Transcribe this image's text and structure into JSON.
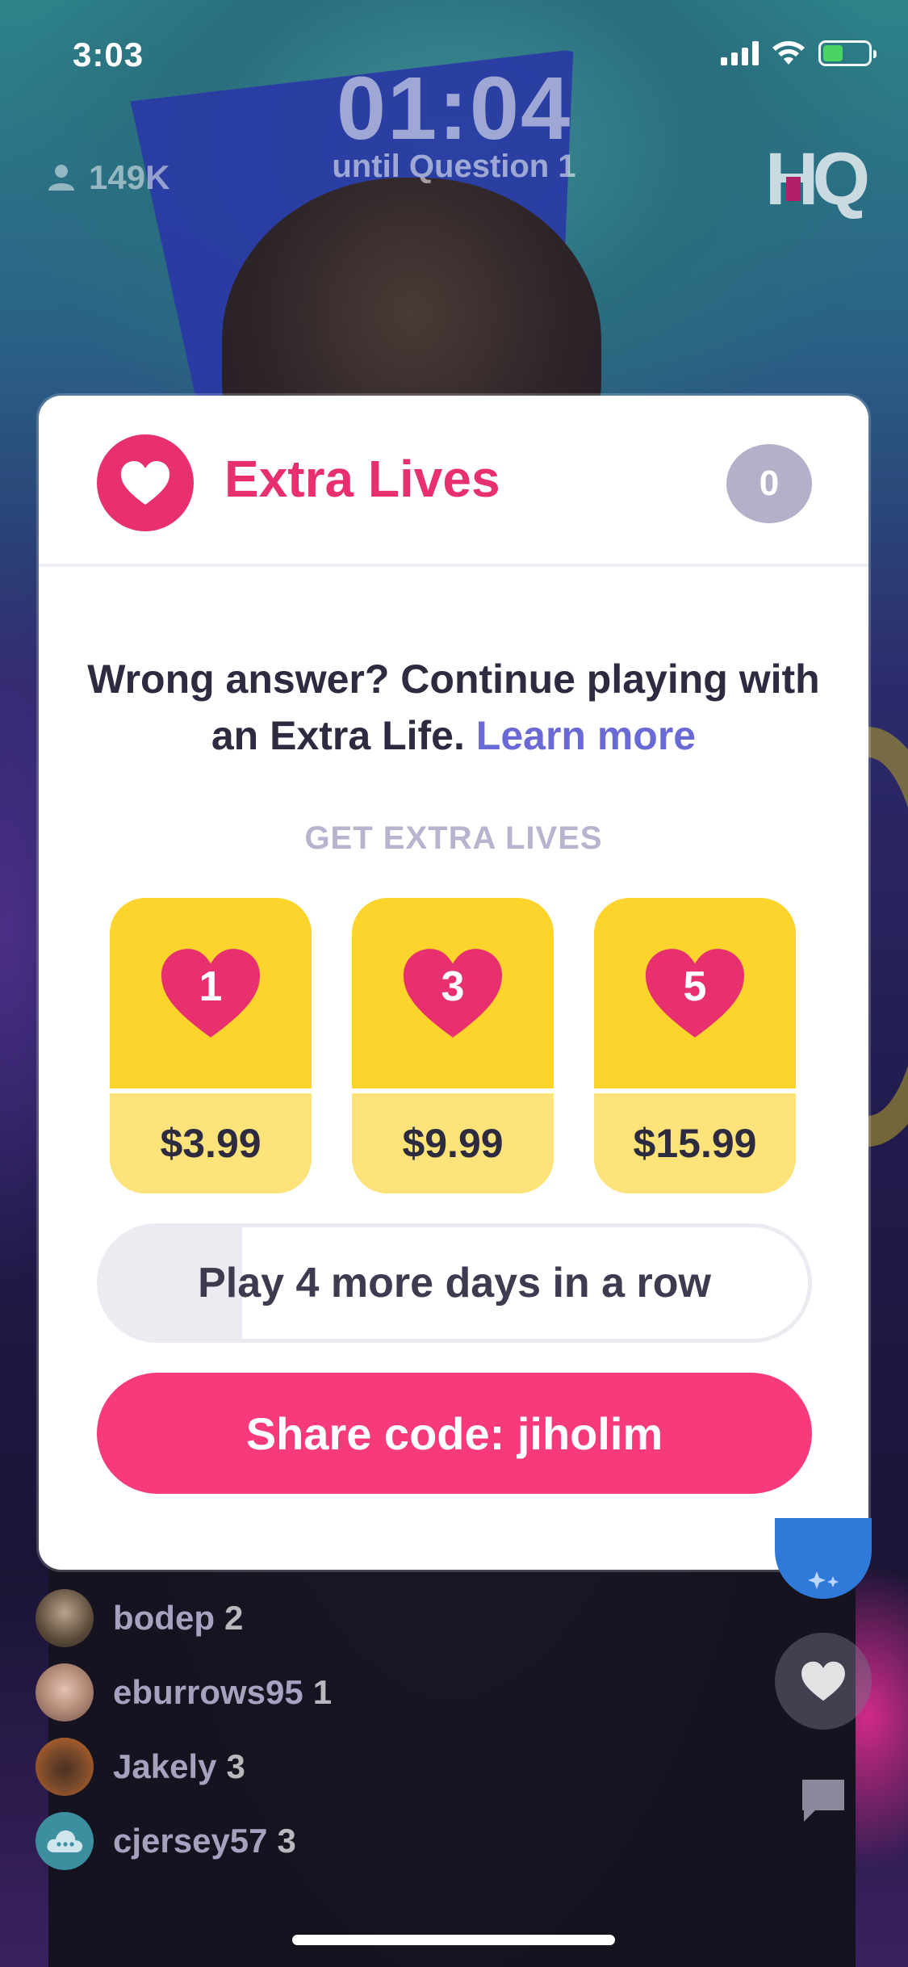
{
  "status_bar": {
    "time": "3:03",
    "signal_icon": "cellular-signal-icon",
    "wifi_icon": "wifi-icon",
    "battery_icon": "battery-charging-icon",
    "battery_color": "#4cd964"
  },
  "hud": {
    "timer": "01:04",
    "timer_label": "until Question 1",
    "viewer_count": "149K",
    "viewer_icon": "person-icon",
    "logo": "HQ"
  },
  "modal": {
    "title": "Extra Lives",
    "title_icon": "heart-icon",
    "lives_count": "0",
    "description": "Wrong answer? Continue playing with an Extra Life.",
    "learn_more": "Learn more",
    "section_label": "GET EXTRA LIVES",
    "packs": [
      {
        "lives": "1",
        "price": "$3.99"
      },
      {
        "lives": "3",
        "price": "$9.99"
      },
      {
        "lives": "5",
        "price": "$15.99"
      }
    ],
    "streak": {
      "text": "Play 4 more days in a row",
      "progress": 0.2
    },
    "share_button": "Share code: jiholim"
  },
  "chat": [
    {
      "name": "bodep",
      "score": "2"
    },
    {
      "name": "eburrows95",
      "score": "1"
    },
    {
      "name": "Jakely",
      "score": "3"
    },
    {
      "name": "cjersey57",
      "score": "3"
    }
  ],
  "side_actions": {
    "heart_icon": "heart-icon",
    "chat_icon": "chat-bubble-icon"
  },
  "colors": {
    "accent_pink": "#e8306e",
    "button_pink": "#f73a78",
    "pack_yellow": "#fdd42c",
    "pack_price_yellow": "#fee27a",
    "link_purple": "#6a6ad7",
    "badge_gray": "#b3b1c9"
  }
}
